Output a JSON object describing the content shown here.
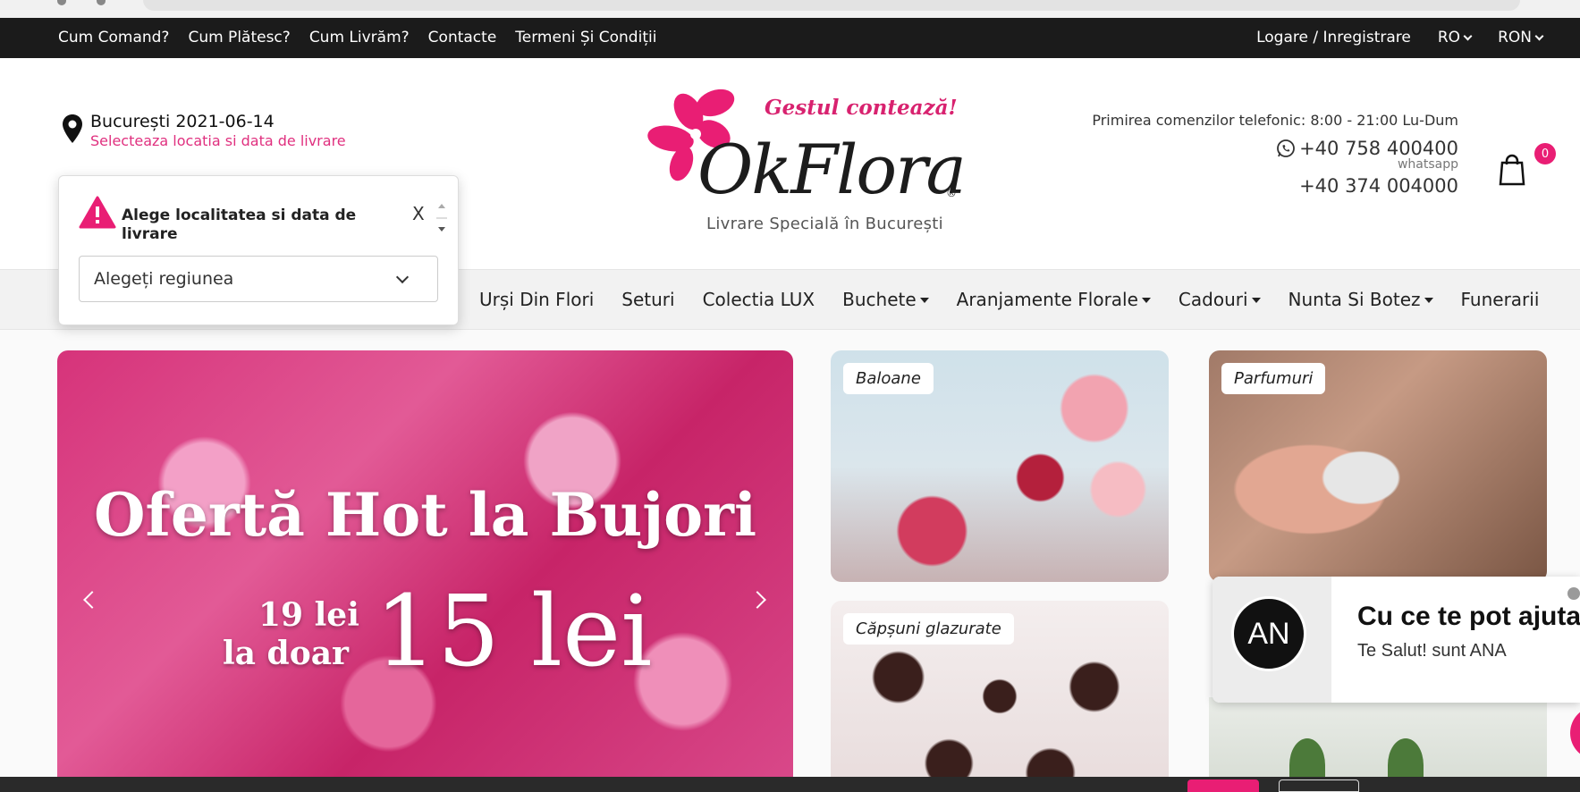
{
  "top_nav": {
    "links": [
      "Cum Comand?",
      "Cum Plătesc?",
      "Cum Livrăm?",
      "Contacte",
      "Termeni Și Condiții"
    ],
    "login": "Logare / Inregistrare",
    "language": "RO",
    "currency": "RON"
  },
  "location": {
    "city_date": "București 2021-06-14",
    "hint": "Selecteaza locatia si data de livrare"
  },
  "logo": {
    "slogan": "Gestul contează!",
    "brand": "OkFlora",
    "registered": "®",
    "tagline": "Livrare Specială în București"
  },
  "contact": {
    "hours": "Primirea comenzilor telefonic: 8:00 - 21:00 Lu-Dum",
    "whatsapp_number": "+40 758 400400",
    "whatsapp_label": "whatsapp",
    "phone": "+40 374 004000"
  },
  "cart": {
    "count": "0"
  },
  "menu": {
    "items": [
      {
        "label": "Urși Din Flori"
      },
      {
        "label": "Seturi"
      },
      {
        "label": "Colectia LUX"
      },
      {
        "label": "Buchete"
      },
      {
        "label": "Aranjamente Florale"
      },
      {
        "label": "Cadouri"
      },
      {
        "label": "Nunta Si Botez"
      },
      {
        "label": "Funerarii"
      }
    ]
  },
  "popup": {
    "title": "Alege localitatea si data de livrare",
    "close": "X",
    "select_value": "Alegeți regiunea"
  },
  "hero": {
    "headline": "Ofertă Hot la Bujori",
    "old_price": "19 lei",
    "only": "la doar",
    "new_price": "15 lei"
  },
  "tiles": {
    "baloane": "Baloane",
    "parfumuri": "Parfumuri",
    "capsuni": "Căpșuni glazurate"
  },
  "chat": {
    "avatar": "AN",
    "question": "Cu ce te pot ajuta?",
    "greeting": "Te Salut! sunt ANA"
  },
  "colors": {
    "accent": "#e91e74",
    "topbar": "#1b1b1b"
  }
}
